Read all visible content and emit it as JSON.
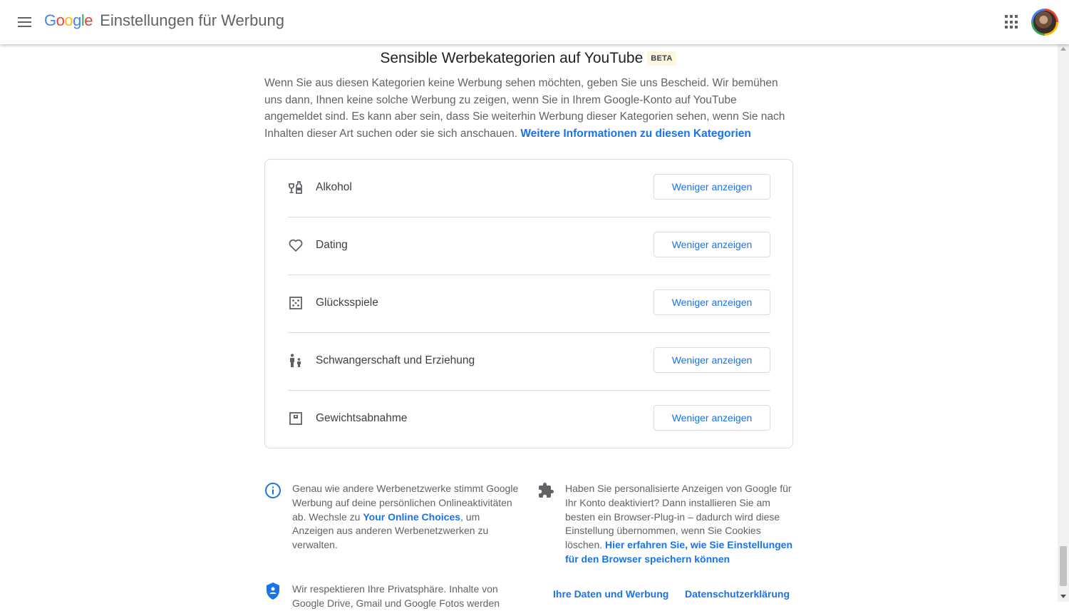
{
  "header": {
    "logo_letters": [
      {
        "ch": "G",
        "color": "#4285f4"
      },
      {
        "ch": "o",
        "color": "#ea4335"
      },
      {
        "ch": "o",
        "color": "#fbbc05"
      },
      {
        "ch": "g",
        "color": "#4285f4"
      },
      {
        "ch": "l",
        "color": "#34a853"
      },
      {
        "ch": "e",
        "color": "#ea4335"
      }
    ],
    "title": "Einstellungen für Werbung",
    "menu_icon": "hamburger-menu-icon",
    "apps_icon": "apps-grid-icon",
    "avatar": "account-avatar"
  },
  "section": {
    "title": "Sensible Werbekategorien auf YouTube",
    "badge": "BETA",
    "intro": "Wenn Sie aus diesen Kategorien keine Werbung sehen möchten, geben Sie uns Bescheid. Wir bemühen uns dann, Ihnen keine solche Werbung zu zeigen, wenn Sie in Ihrem Google-Konto auf YouTube angemeldet sind. Es kann aber sein, dass Sie weiterhin Werbung dieser Kategorien sehen, wenn Sie nach Inhalten dieser Art suchen oder sie sich anschauen.",
    "intro_link": "Weitere Informationen zu diesen Kategorien"
  },
  "categories": [
    {
      "label": "Alkohol",
      "icon": "alcohol-icon",
      "button": "Weniger anzeigen"
    },
    {
      "label": "Dating",
      "icon": "heart-icon",
      "button": "Weniger anzeigen"
    },
    {
      "label": "Glücksspiele",
      "icon": "dice-icon",
      "button": "Weniger anzeigen"
    },
    {
      "label": "Schwangerschaft und Erziehung",
      "icon": "parent-child-icon",
      "button": "Weniger anzeigen"
    },
    {
      "label": "Gewichtsabnahme",
      "icon": "scale-icon",
      "button": "Weniger anzeigen"
    }
  ],
  "footer": {
    "info_left_pre": "Genau wie andere Werbenetzwerke stimmt Google Werbung auf deine persönlichen Onlineaktivitäten ab. Wechsle zu ",
    "info_left_link": "Your Online Choices",
    "info_left_post": ", um Anzeigen aus anderen Werbenetzwerken zu verwalten.",
    "info_right_pre": "Haben Sie personalisierte Anzeigen von Google für Ihr Konto deaktiviert? Dann installieren Sie am besten ein Browser-Plug-in – dadurch wird diese Einstellung übernommen, wenn Sie Cookies löschen. ",
    "info_right_link": "Hier erfahren Sie, wie Sie Einstellungen für den Browser speichern können",
    "privacy_text": "Wir respektieren Ihre Privatsphäre. Inhalte von Google Drive, Gmail und Google Fotos werden",
    "link_data": "Ihre Daten und Werbung",
    "link_privacy": "Datenschutzerklärung"
  },
  "colors": {
    "accent": "#1a73e8",
    "info_icon": "#1a73e8",
    "shield_icon": "#1a73e8",
    "beta_bg": "#fef7e0"
  }
}
